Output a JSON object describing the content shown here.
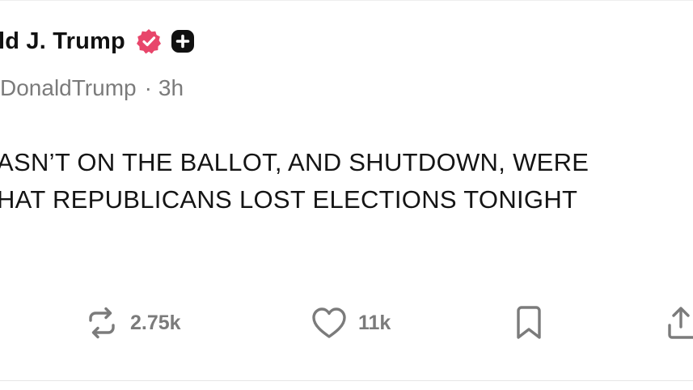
{
  "post": {
    "author": {
      "display_name": "ld J. Trump",
      "handle": "DonaldTrump",
      "separator": "·",
      "time_ago": "3h",
      "verified_icon": "verified-check-icon",
      "plus_icon": "plus-badge-icon",
      "verified_color": "#e8466b"
    },
    "body_lines": [
      "ASN’T ON THE BALLOT, AND SHUTDOWN, WERE",
      "HAT REPUBLICANS LOST ELECTIONS TONIGHT"
    ],
    "actions": {
      "repost": {
        "icon": "repost-icon",
        "count": "2.75k"
      },
      "like": {
        "icon": "heart-icon",
        "count": "11k"
      },
      "bookmark": {
        "icon": "bookmark-icon"
      },
      "share": {
        "icon": "share-icon"
      }
    }
  },
  "colors": {
    "text": "#111111",
    "muted": "#7b7b7b",
    "divider": "#e6e6e6"
  }
}
